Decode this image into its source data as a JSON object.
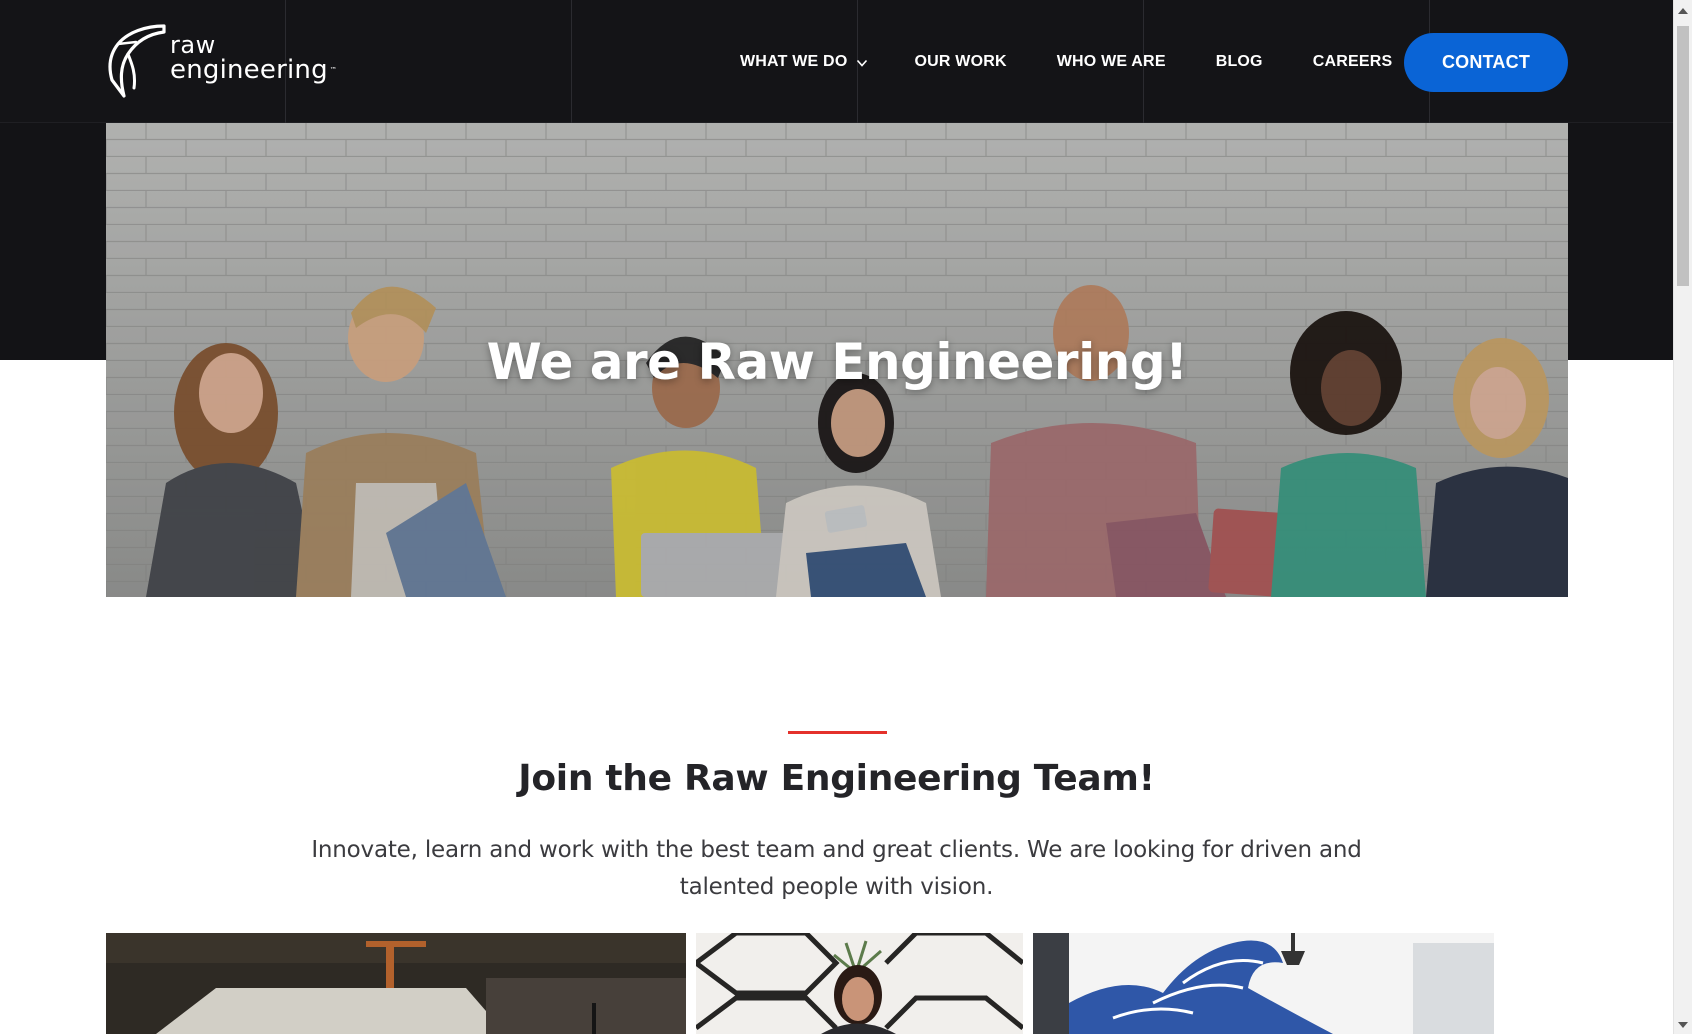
{
  "brand": {
    "logo_line1": "raw",
    "logo_line2": "engineering",
    "logo_tm": "™"
  },
  "nav": {
    "items": [
      {
        "label": "WHAT WE DO",
        "has_dropdown": true
      },
      {
        "label": "OUR WORK"
      },
      {
        "label": "WHO WE ARE"
      },
      {
        "label": "BLOG"
      },
      {
        "label": "CAREERS"
      }
    ],
    "contact_label": "CONTACT"
  },
  "hero": {
    "title": "We are Raw Engineering!"
  },
  "join": {
    "title": "Join the Raw Engineering Team!",
    "text": "Innovate, learn and work with the best team and great clients. We are looking for driven and talented people with vision."
  },
  "colors": {
    "header_bg": "#141417",
    "accent_blue": "#0a64d6",
    "accent_red": "#e4312b"
  },
  "icons": {
    "dropdown": "chevron-down-icon",
    "logo": "raw-engineering-logo-mark"
  }
}
